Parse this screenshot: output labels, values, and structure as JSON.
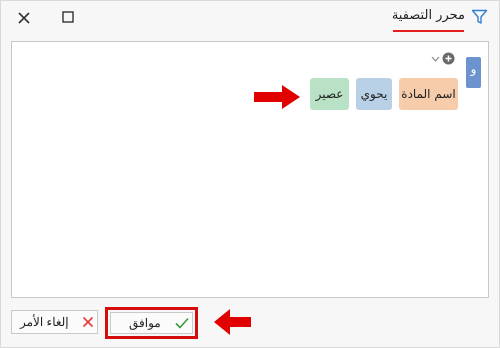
{
  "window": {
    "title": "محرر التصفية"
  },
  "editor": {
    "group_operator": "و",
    "condition": {
      "field": "اسم المادة",
      "operator": "يحوي",
      "value": "عصير"
    }
  },
  "buttons": {
    "ok_label": "موافق",
    "cancel_label": "إلغاء الأمر"
  },
  "colors": {
    "accent": "#e41e1e",
    "group_tag": "#6d93cf",
    "field_chip": "#f6ccab",
    "operator_chip": "#b8d1e6",
    "value_chip": "#b9e1c5",
    "ok_check": "#3a9a3a",
    "cancel_x": "#e23b3b"
  },
  "icons": {
    "title": "filter-icon",
    "close": "close-icon",
    "maximize": "maximize-icon",
    "add": "add-circle-icon",
    "dropdown": "chevron-down-icon",
    "ok": "check-icon",
    "cancel": "x-icon",
    "annotation": "red-arrow-icon"
  }
}
